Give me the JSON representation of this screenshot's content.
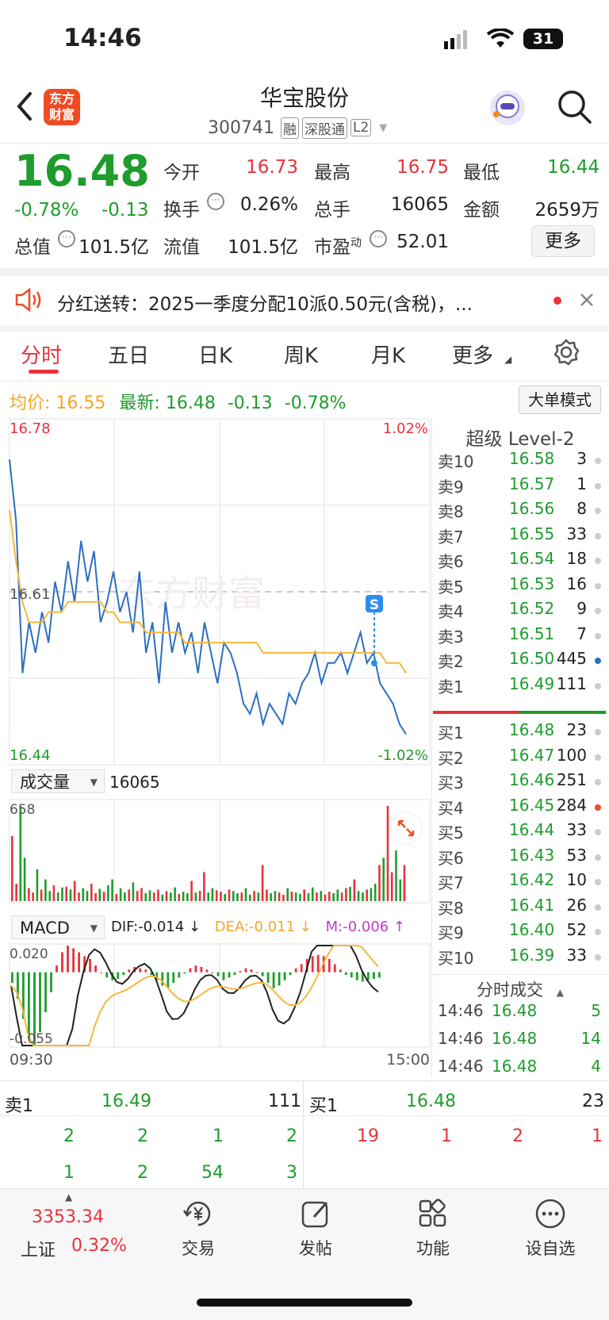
{
  "status_bar": {
    "time": "14:46",
    "battery": "31"
  },
  "header": {
    "title": "华宝股份",
    "code": "300741",
    "badges": [
      "融",
      "深股通",
      "L2"
    ],
    "logo_text": [
      "东方",
      "财富"
    ]
  },
  "quote": {
    "price": "16.48",
    "change_pct": "-0.78%",
    "change": "-0.13",
    "stats": [
      {
        "label": "今开",
        "value": "16.73"
      },
      {
        "label": "最高",
        "value": "16.75"
      },
      {
        "label": "最低",
        "value": "16.44"
      },
      {
        "label": "换手",
        "value": "0.26%"
      },
      {
        "label": "总手",
        "value": "16065"
      },
      {
        "label": "金额",
        "value": "2659万"
      },
      {
        "label": "总值",
        "value": "101.5亿"
      },
      {
        "label": "流值",
        "value": "101.5亿"
      },
      {
        "label": "市盈",
        "value": "52.01"
      }
    ],
    "pe_sup": "动",
    "more_button": "更多"
  },
  "notice": {
    "text": "分红送转：2025一季度分配10派0.50元(含税)，..."
  },
  "tabs": [
    "分时",
    "五日",
    "日K",
    "周K",
    "月K",
    "更多"
  ],
  "info_line": {
    "avg_label": "均价:",
    "avg_value": "16.55",
    "latest_label": "最新:",
    "latest_value": "16.48",
    "change": "-0.13",
    "change_pct": "-0.78%",
    "big_order_button": "大单模式"
  },
  "chart_data": [
    {
      "type": "line",
      "x_range": [
        "09:30",
        "15:00"
      ],
      "y_max": "16.78",
      "y_min": "16.44",
      "y_ref": "16.61",
      "pct_max": "1.02%",
      "pct_min": "-1.02%",
      "watermark": "东方财富",
      "marker": "S",
      "series": [
        {
          "values": [
            16.74,
            16.68,
            16.53,
            16.58,
            16.55,
            16.59,
            16.56,
            16.62,
            16.59,
            16.64,
            16.6,
            16.66,
            16.62,
            16.65,
            16.58,
            16.6,
            16.63,
            16.59,
            16.61,
            16.57,
            16.63,
            16.55,
            16.58,
            16.52,
            16.6,
            16.55,
            16.58,
            16.55,
            16.57,
            16.53,
            16.58,
            16.55,
            16.52,
            16.56,
            16.55,
            16.53,
            16.5,
            16.49,
            16.51,
            16.48,
            16.5,
            16.49,
            16.48,
            16.51,
            16.5,
            16.52,
            16.53,
            16.55,
            16.52,
            16.54,
            16.54,
            16.55,
            16.53,
            16.55,
            16.57,
            16.54,
            16.55,
            16.52,
            16.51,
            16.5,
            16.48,
            16.47
          ]
        },
        {
          "values": [
            16.69,
            16.64,
            16.6,
            16.58,
            16.58,
            16.58,
            16.59,
            16.59,
            16.59,
            16.6,
            16.6,
            16.6,
            16.6,
            16.6,
            16.6,
            16.59,
            16.59,
            16.58,
            16.58,
            16.58,
            16.58,
            16.57,
            16.57,
            16.57,
            16.57,
            16.57,
            16.57,
            16.56,
            16.56,
            16.56,
            16.56,
            16.56,
            16.56,
            16.56,
            16.56,
            16.56,
            16.56,
            16.56,
            16.56,
            16.55,
            16.55,
            16.55,
            16.55,
            16.55,
            16.55,
            16.55,
            16.55,
            16.55,
            16.55,
            16.55,
            16.55,
            16.55,
            16.55,
            16.55,
            16.55,
            16.55,
            16.55,
            16.55,
            16.54,
            16.54,
            16.54,
            16.53
          ]
        }
      ]
    },
    {
      "type": "bar",
      "title": "成交量",
      "total": "16065",
      "y_max": "658",
      "values": [
        450,
        120,
        658,
        300,
        90,
        60,
        220,
        80,
        150,
        70,
        110,
        60,
        95,
        100,
        80,
        140,
        60,
        90,
        70,
        120,
        55,
        85,
        65,
        110,
        150,
        50,
        90,
        60,
        80,
        130,
        70,
        90,
        55,
        75,
        60,
        80,
        45,
        70,
        60,
        95,
        50,
        65,
        55,
        140,
        60,
        70,
        200,
        60,
        90,
        75,
        65,
        50,
        80,
        70,
        55,
        60,
        90,
        45,
        70,
        60,
        250,
        80,
        55,
        70,
        60,
        45,
        90,
        65,
        60,
        50,
        80,
        55,
        95,
        60,
        70,
        45,
        65,
        55,
        80,
        60,
        90,
        100,
        150,
        70,
        60,
        80,
        90,
        120,
        250,
        300,
        658,
        200,
        350,
        150,
        250
      ]
    },
    {
      "type": "bar",
      "title": "MACD",
      "dif": "DIF:-0.014 ↓",
      "dea": "DEA:-0.011 ↓",
      "m": "M:-0.006 ↑",
      "y_max": "0.020",
      "y_min": "-0.055",
      "values": [
        -0.008,
        -0.02,
        -0.035,
        -0.05,
        -0.055,
        -0.045,
        -0.03,
        -0.015,
        0.005,
        0.015,
        0.02,
        0.018,
        0.015,
        0.012,
        0.01,
        0.005,
        0.0,
        -0.004,
        -0.006,
        -0.005,
        -0.002,
        0.002,
        0.004,
        0.003,
        0.002,
        -0.002,
        -0.006,
        -0.01,
        -0.012,
        -0.008,
        -0.004,
        -0.001,
        0.003,
        0.005,
        0.004,
        0.002,
        0.0,
        -0.003,
        -0.006,
        -0.004,
        -0.002,
        0.001,
        0.003,
        0.002,
        0.0,
        -0.003,
        -0.008,
        -0.012,
        -0.01,
        -0.006,
        -0.002,
        0.003,
        0.006,
        0.01,
        0.012,
        0.013,
        0.012,
        0.01,
        0.006,
        0.002,
        -0.002,
        -0.004,
        -0.006,
        -0.007,
        -0.006,
        -0.005,
        -0.004
      ]
    }
  ],
  "order_book": {
    "title": "超级 Level-2",
    "sells": [
      {
        "label": "卖10",
        "price": "16.58",
        "vol": "3"
      },
      {
        "label": "卖9",
        "price": "16.57",
        "vol": "1"
      },
      {
        "label": "卖8",
        "price": "16.56",
        "vol": "8"
      },
      {
        "label": "卖7",
        "price": "16.55",
        "vol": "33"
      },
      {
        "label": "卖6",
        "price": "16.54",
        "vol": "18"
      },
      {
        "label": "卖5",
        "price": "16.53",
        "vol": "16"
      },
      {
        "label": "卖4",
        "price": "16.52",
        "vol": "9"
      },
      {
        "label": "卖3",
        "price": "16.51",
        "vol": "7"
      },
      {
        "label": "卖2",
        "price": "16.50",
        "vol": "445"
      },
      {
        "label": "卖1",
        "price": "16.49",
        "vol": "111"
      }
    ],
    "buys": [
      {
        "label": "买1",
        "price": "16.48",
        "vol": "23"
      },
      {
        "label": "买2",
        "price": "16.47",
        "vol": "100"
      },
      {
        "label": "买3",
        "price": "16.46",
        "vol": "251"
      },
      {
        "label": "买4",
        "price": "16.45",
        "vol": "284"
      },
      {
        "label": "买5",
        "price": "16.44",
        "vol": "33"
      },
      {
        "label": "买6",
        "price": "16.43",
        "vol": "53"
      },
      {
        "label": "买7",
        "price": "16.42",
        "vol": "10"
      },
      {
        "label": "买8",
        "price": "16.41",
        "vol": "26"
      },
      {
        "label": "买9",
        "price": "16.40",
        "vol": "52"
      },
      {
        "label": "买10",
        "price": "16.39",
        "vol": "33"
      }
    ],
    "trades_title": "分时成交",
    "trades": [
      {
        "time": "14:46",
        "price": "16.48",
        "vol": "5"
      },
      {
        "time": "14:46",
        "price": "16.48",
        "vol": "14"
      },
      {
        "time": "14:46",
        "price": "16.48",
        "vol": "4"
      }
    ]
  },
  "queue": {
    "sell_label": "卖1",
    "sell_price": "16.49",
    "sell_vol": "111",
    "buy_label": "买1",
    "buy_price": "16.48",
    "buy_vol": "23",
    "sell_row1": [
      "2",
      "2",
      "1",
      "2"
    ],
    "sell_row2": [
      "1",
      "2",
      "54",
      "3"
    ],
    "buy_row1": [
      "19",
      "1",
      "2",
      "1"
    ]
  },
  "bottom_nav": {
    "index_value": "3353.34",
    "index_name": "上证",
    "index_pct": "0.32%",
    "items": [
      {
        "label": "交易",
        "icon": "yen-icon"
      },
      {
        "label": "发帖",
        "icon": "edit-icon"
      },
      {
        "label": "功能",
        "icon": "grid-icon"
      },
      {
        "label": "设自选",
        "icon": "more-icon"
      }
    ]
  },
  "colors": {
    "up": "#e8323c",
    "down": "#1e9c2c",
    "price_line": "#2c6fc0",
    "avg_line": "#f5b73d",
    "tab_active": "#e8323c"
  }
}
